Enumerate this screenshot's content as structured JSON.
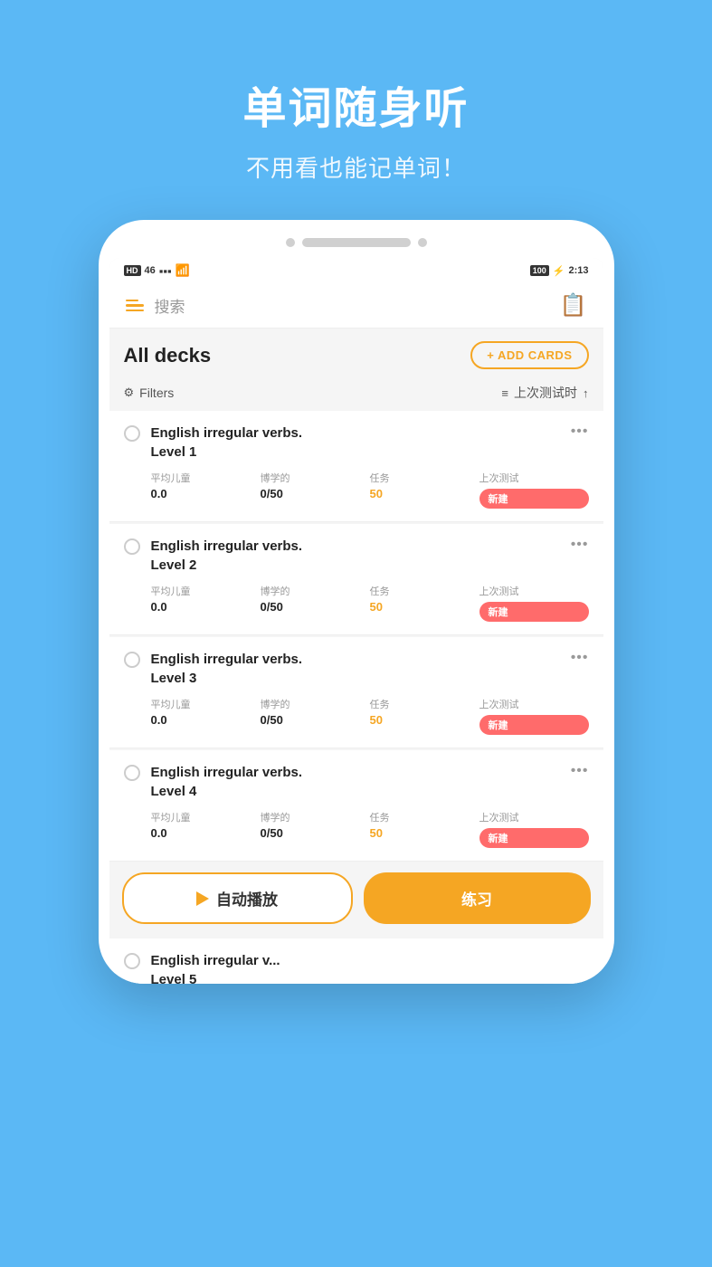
{
  "hero": {
    "title": "单词随身听",
    "subtitle": "不用看也能记单词！"
  },
  "status_bar": {
    "left": "HD 46 ▪ ull ≋",
    "hd": "HD",
    "signal": "46",
    "bars": "▪",
    "wifi": "≋",
    "battery": "100",
    "bolt": "⚡",
    "time": "2:13"
  },
  "nav": {
    "search_placeholder": "搜索",
    "clipboard_icon": "📋"
  },
  "decks_section": {
    "title": "All decks",
    "add_cards_label": "+ ADD CARDS",
    "filters_label": "Filters",
    "sort_label": "上次测试时"
  },
  "decks": [
    {
      "name": "English irregular verbs.\nLevel 1",
      "stats": {
        "avg_label": "平均儿童",
        "avg_value": "0.0",
        "learned_label": "博学的",
        "learned_value": "0/50",
        "task_label": "任务",
        "task_value": "50",
        "last_test_label": "上次测试",
        "last_test_badge": "新建"
      }
    },
    {
      "name": "English irregular verbs.\nLevel 2",
      "stats": {
        "avg_label": "平均儿童",
        "avg_value": "0.0",
        "learned_label": "博学的",
        "learned_value": "0/50",
        "task_label": "任务",
        "task_value": "50",
        "last_test_label": "上次测试",
        "last_test_badge": "新建"
      }
    },
    {
      "name": "English irregular verbs.\nLevel 3",
      "stats": {
        "avg_label": "平均儿童",
        "avg_value": "0.0",
        "learned_label": "博学的",
        "learned_value": "0/50",
        "task_label": "任务",
        "task_value": "50",
        "last_test_label": "上次测试",
        "last_test_badge": "新建"
      }
    },
    {
      "name": "English irregular verbs.\nLevel 4",
      "stats": {
        "avg_label": "平均儿童",
        "avg_value": "0.0",
        "learned_label": "博学的",
        "learned_value": "0/50",
        "task_label": "任务",
        "task_value": "50",
        "last_test_label": "上次测试",
        "last_test_badge": "新建"
      }
    }
  ],
  "partial_deck": {
    "name": "English irregular v...\nLevel 5"
  },
  "bottom_buttons": {
    "autoplay_label": "自动播放",
    "practice_label": "练习"
  },
  "colors": {
    "orange": "#f5a623",
    "bg_blue": "#5bb8f5",
    "badge_red": "#ff6b6b"
  }
}
